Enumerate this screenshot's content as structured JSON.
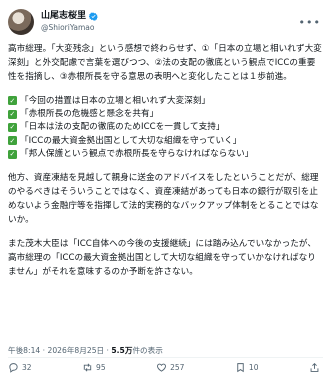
{
  "author": {
    "display_name": "山尾志桜里",
    "handle": "@ShioriYamao",
    "more_icon": "more-icon"
  },
  "intro": "高市総理。「大変残念」という感想で終わらせず、①「日本の立場と相いれず大変深刻」と外交配慮で言葉を選びつつ、②法の支配の徹底という観点でICCの重要性を指摘し、③赤根所長を守る意思の表明へと変化したことは１歩前進。",
  "checklist": [
    "「今回の措置は日本の立場と相いれず大変深刻」",
    "「赤根所長の危機感と懸念を共有」",
    "「日本は法の支配の徹底のためICCを一貫して支持」",
    "「ICCの最大資金拠出国として大切な組織を守っていく」",
    "「邦人保護という観点で赤根所長を守らなければならない」"
  ],
  "para2": "他方、資産凍結を見越して親身に送金のアドバイスをしたということだが、総理のやるべきはそういうことではなく、資産凍結があっても日本の銀行が取引を止めないよう金融庁等を指揮して法的実務的なバックアップ体制をとることではないか。",
  "para3": "また茂木大臣は「ICC自体への今後の支援継続」には踏み込んでいなかったが、高市総理の「ICCの最大資金拠出国として大切な組織を守っていかなければなりません」がそれを意味するのか予断を許さない。",
  "meta": {
    "time": "午後8:14",
    "separator": "·",
    "date": "2026年8月25日",
    "views_count": "5.5万",
    "views_label": "件の表示"
  },
  "actions": {
    "reply_count": "32",
    "retweet_count": "95",
    "like_count": "257",
    "bookmark_count": "10"
  },
  "colors": {
    "check_green": "#3fa23b",
    "verified_blue": "#1d9bf0"
  }
}
